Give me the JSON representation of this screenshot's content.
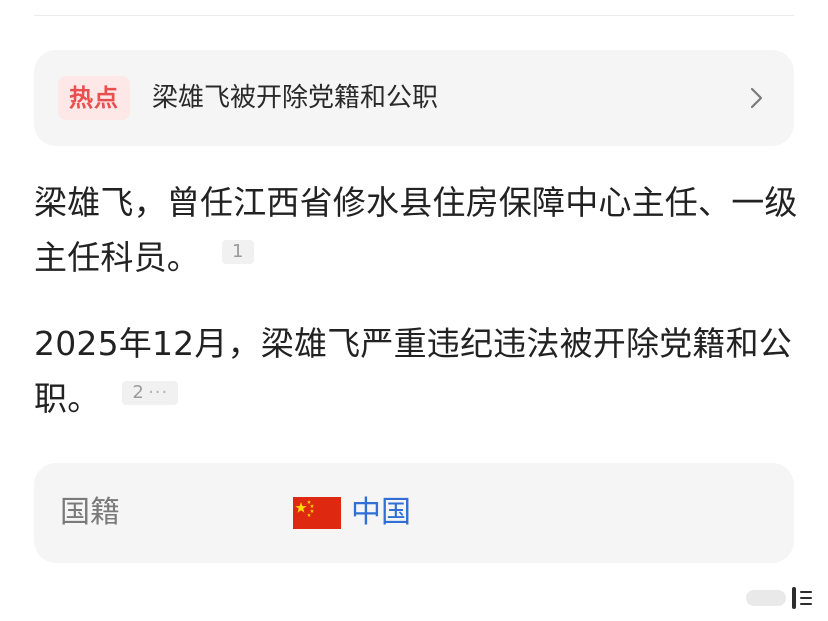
{
  "hotspot": {
    "badge": "热点",
    "title": "梁雄飞被开除党籍和公职",
    "chevron_icon": "chevron-right-icon"
  },
  "paragraphs": [
    {
      "text": "梁雄飞，曾任江西省修水县住房保障中心主任、一级主任科员。",
      "citation": "1"
    },
    {
      "text": "2025年12月，梁雄飞严重违纪违法被开除党籍和公职。",
      "citation": "2",
      "citation_more": "···"
    }
  ],
  "info": {
    "label": "国籍",
    "value": "中国",
    "flag_icon": "china-flag-icon"
  },
  "colors": {
    "badge_bg": "#fde7e7",
    "badge_text": "#e84f4f",
    "card_bg": "#f5f5f6",
    "link": "#2f6fd6",
    "flag_red": "#de2910",
    "flag_yellow": "#ffde00"
  }
}
